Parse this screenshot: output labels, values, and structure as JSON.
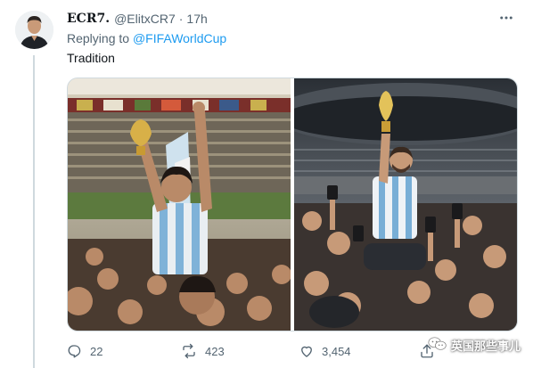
{
  "tweet": {
    "display_name": "ECR7.",
    "handle": "@ElitxCR7",
    "separator": "·",
    "time": "17h",
    "reply_prefix": "Replying to",
    "reply_to": "@FIFAWorldCup",
    "text": "Tradition",
    "avatar_icon": "profile-photo-avatar",
    "more_icon": "more-horizontal-icon"
  },
  "media": {
    "images": [
      {
        "label": "Maradona lifting World Cup trophy (1986)",
        "icon": "photo-left"
      },
      {
        "label": "Messi lifting World Cup trophy (2022)",
        "icon": "photo-right"
      }
    ]
  },
  "actions": {
    "reply_icon": "reply-icon",
    "reply_count": "22",
    "retweet_icon": "retweet-icon",
    "retweet_count": "423",
    "like_icon": "heart-icon",
    "like_count": "3,454",
    "share_icon": "share-icon"
  },
  "watermark": {
    "text": "英国那些事儿",
    "icon": "wechat-icon"
  },
  "colors": {
    "accent": "#1d9bf0",
    "muted": "#536471",
    "text": "#0f1419",
    "border": "#cfd9de"
  }
}
